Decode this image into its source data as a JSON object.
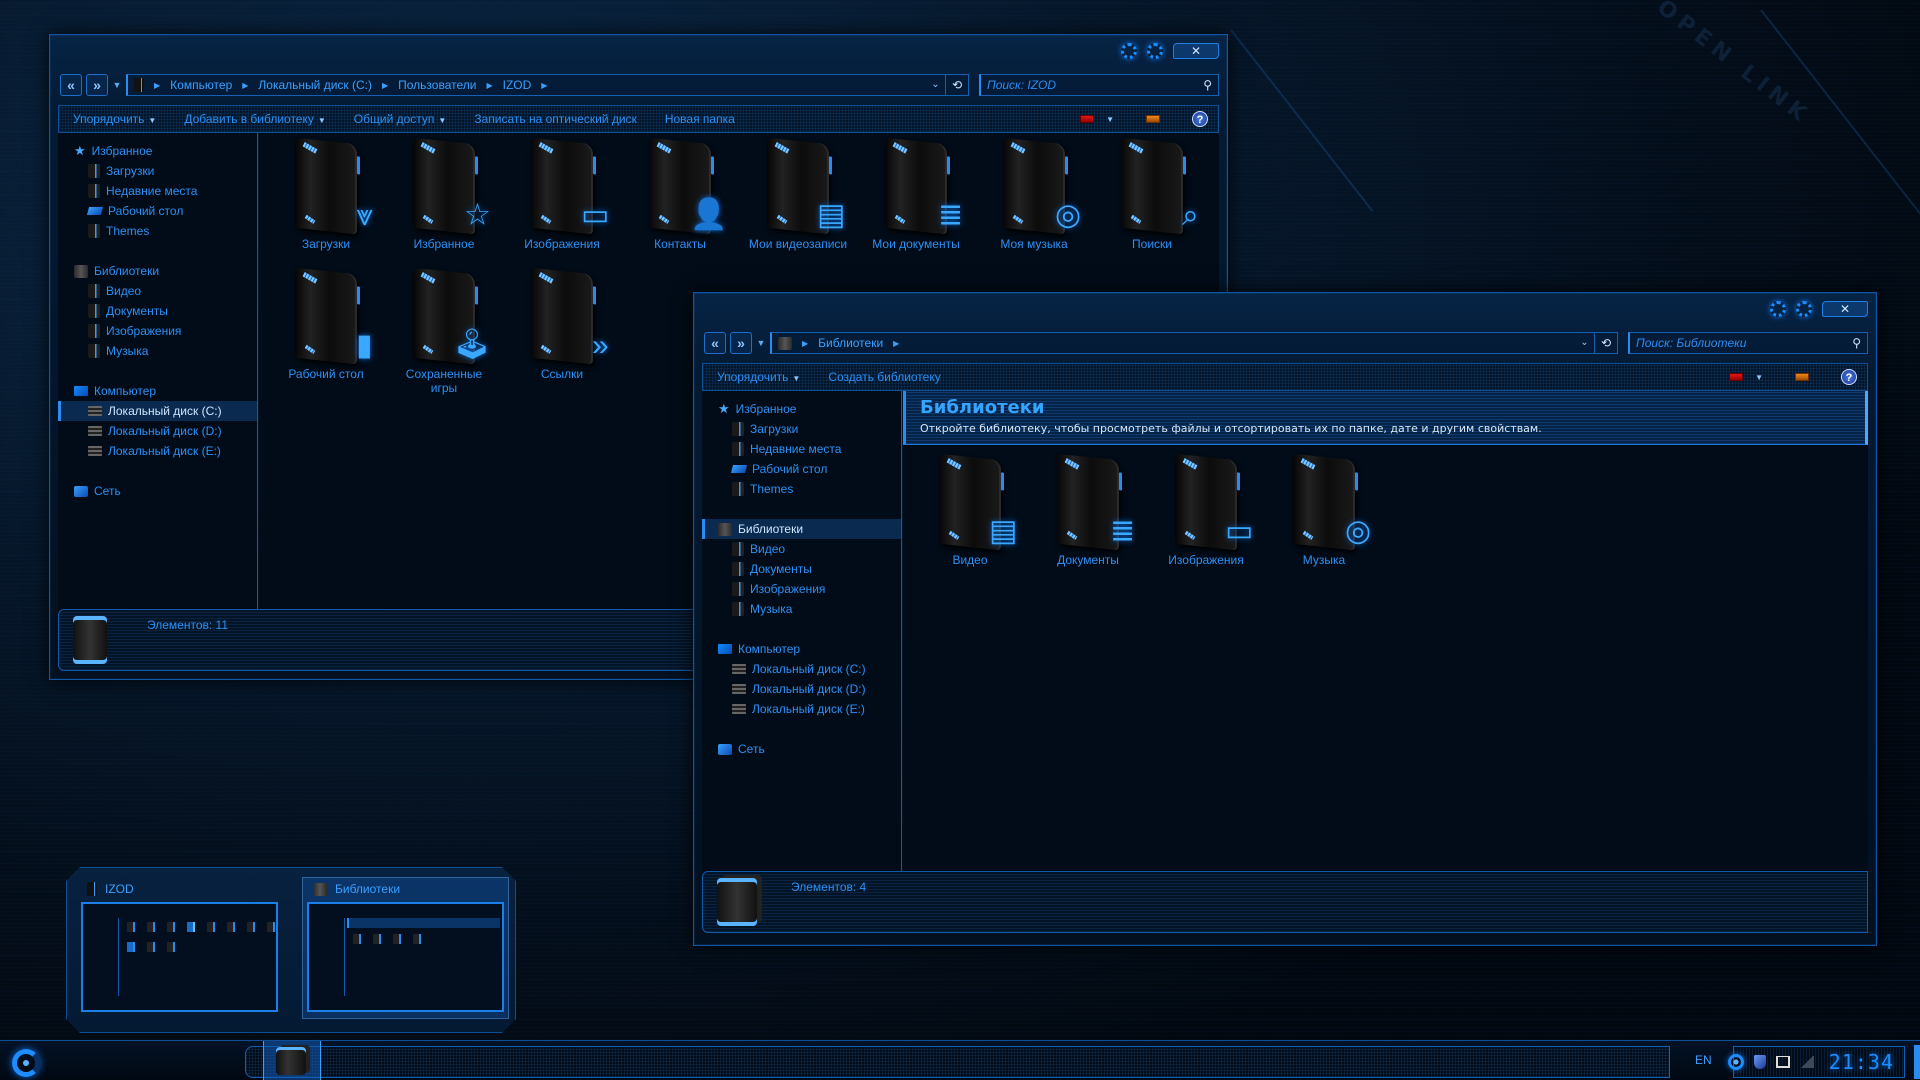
{
  "background": {
    "decor_text": "OPEN LINK"
  },
  "window_izod": {
    "title": "IZOD",
    "breadcrumb": [
      "Компьютер",
      "Локальный диск (C:)",
      "Пользователи",
      "IZOD"
    ],
    "search_placeholder": "Поиск: IZOD",
    "toolbar": {
      "items": [
        {
          "label": "Упорядочить",
          "has_menu": true
        },
        {
          "label": "Добавить в библиотеку",
          "has_menu": true
        },
        {
          "label": "Общий доступ",
          "has_menu": true
        },
        {
          "label": "Записать на оптический диск",
          "has_menu": false
        },
        {
          "label": "Новая папка",
          "has_menu": false
        }
      ]
    },
    "sidebar": {
      "favorites": {
        "label": "Избранное",
        "items": [
          "Загрузки",
          "Недавние места",
          "Рабочий стол",
          "Themes"
        ]
      },
      "libraries": {
        "label": "Библиотеки",
        "items": [
          "Видео",
          "Документы",
          "Изображения",
          "Музыка"
        ]
      },
      "computer": {
        "label": "Компьютер",
        "items": [
          "Локальный диск (C:)",
          "Локальный диск (D:)",
          "Локальный диск (E:)"
        ],
        "selected": "Локальный диск (C:)"
      },
      "network": {
        "label": "Сеть"
      }
    },
    "items": [
      {
        "label": "Загрузки",
        "icon": "download-folder-icon",
        "glyph": "⩔"
      },
      {
        "label": "Избранное",
        "icon": "favorites-folder-icon",
        "glyph": "☆"
      },
      {
        "label": "Изображения",
        "icon": "pictures-folder-icon",
        "glyph": "▭"
      },
      {
        "label": "Контакты",
        "icon": "contacts-folder-icon",
        "glyph": "👤"
      },
      {
        "label": "Мои видеозаписи",
        "icon": "videos-folder-icon",
        "glyph": "▤"
      },
      {
        "label": "Мои документы",
        "icon": "documents-folder-icon",
        "glyph": "≣"
      },
      {
        "label": "Моя музыка",
        "icon": "music-folder-icon",
        "glyph": "◎"
      },
      {
        "label": "Поиски",
        "icon": "searches-folder-icon",
        "glyph": "⌕"
      },
      {
        "label": "Рабочий стол",
        "icon": "desktop-folder-icon",
        "glyph": "▮"
      },
      {
        "label": "Сохраненные игры",
        "icon": "saved-games-folder-icon",
        "glyph": "🕹"
      },
      {
        "label": "Ссылки",
        "icon": "links-folder-icon",
        "glyph": "»"
      }
    ],
    "status": "Элементов: 11"
  },
  "window_libraries": {
    "title": "Библиотеки",
    "breadcrumb": [
      "Библиотеки"
    ],
    "search_placeholder": "Поиск: Библиотеки",
    "toolbar": {
      "items": [
        {
          "label": "Упорядочить",
          "has_menu": true
        },
        {
          "label": "Создать библиотеку",
          "has_menu": false
        }
      ]
    },
    "sidebar": {
      "favorites": {
        "label": "Избранное",
        "items": [
          "Загрузки",
          "Недавние места",
          "Рабочий стол",
          "Themes"
        ]
      },
      "libraries": {
        "label": "Библиотеки",
        "items": [
          "Видео",
          "Документы",
          "Изображения",
          "Музыка"
        ],
        "selected": "Библиотеки"
      },
      "computer": {
        "label": "Компьютер",
        "items": [
          "Локальный диск (C:)",
          "Локальный диск (D:)",
          "Локальный диск (E:)"
        ]
      },
      "network": {
        "label": "Сеть"
      }
    },
    "header": {
      "title": "Библиотеки",
      "description": "Откройте библиотеку, чтобы просмотреть файлы и отсортировать их по папке, дате и другим свойствам."
    },
    "items": [
      {
        "label": "Видео",
        "icon": "video-library-icon",
        "glyph": "▤"
      },
      {
        "label": "Документы",
        "icon": "documents-library-icon",
        "glyph": "≣"
      },
      {
        "label": "Изображения",
        "icon": "pictures-library-icon",
        "glyph": "▭"
      },
      {
        "label": "Музыка",
        "icon": "music-library-icon",
        "glyph": "◎"
      }
    ],
    "status": "Элементов: 4"
  },
  "thumbnails": [
    {
      "title": "IZOD",
      "active": false
    },
    {
      "title": "Библиотеки",
      "active": true
    }
  ],
  "taskbar": {
    "language": "EN",
    "clock": "21:34"
  },
  "colors": {
    "accent": "#1e8fff",
    "text": "#2b90f5",
    "border": "#0e5aad",
    "background": "#020c18"
  }
}
